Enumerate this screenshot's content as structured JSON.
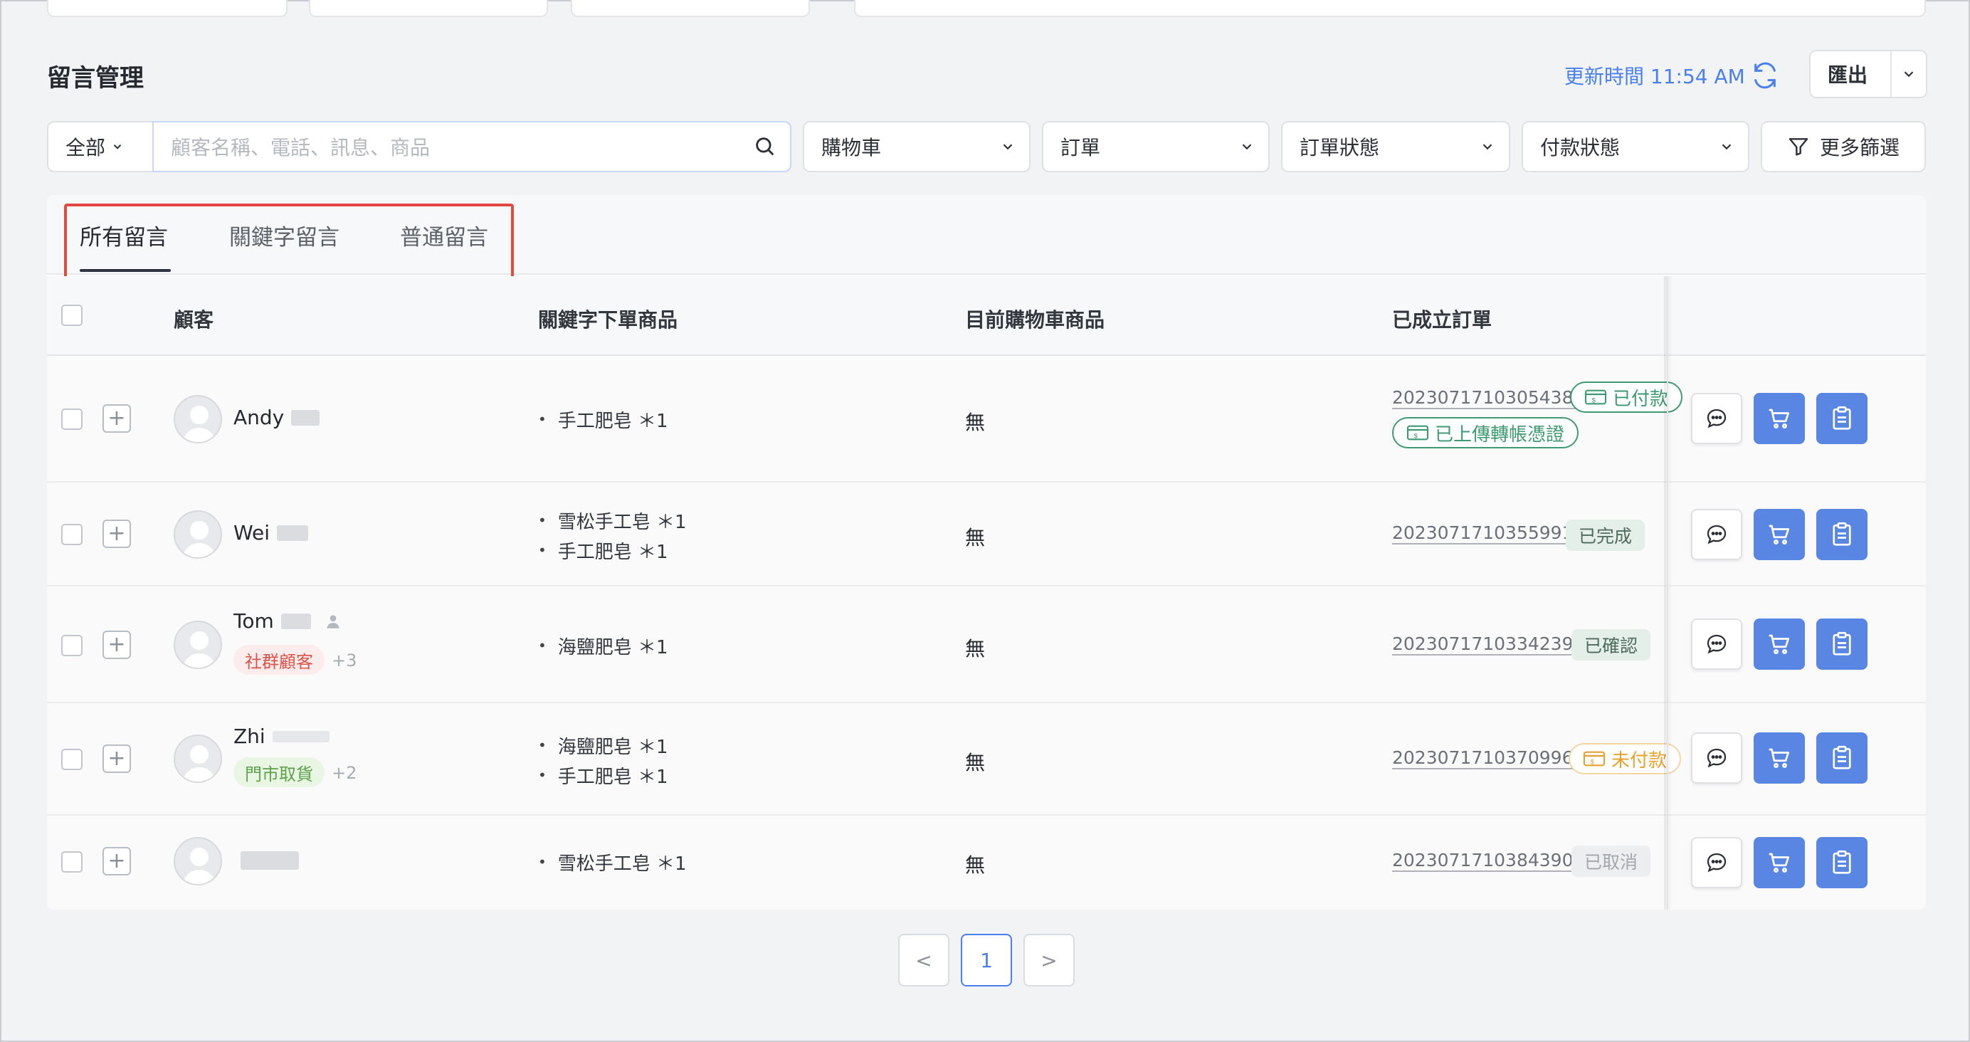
{
  "page": {
    "title": "留言管理",
    "update_label": "更新時間 11:54 AM",
    "export_label": "匯出"
  },
  "filters": {
    "scope": "全部",
    "search_placeholder": "顧客名稱、電話、訊息、商品",
    "cart": "購物車",
    "order": "訂單",
    "order_status": "訂單狀態",
    "payment_status": "付款狀態",
    "more": "更多篩選"
  },
  "tabs": [
    "所有留言",
    "關鍵字留言",
    "普通留言"
  ],
  "columns": {
    "customer": "顧客",
    "keyword_products": "關鍵字下單商品",
    "cart_products": "目前購物車商品",
    "orders": "已成立訂單"
  },
  "rows": [
    {
      "name": "Andy",
      "products": [
        "手工肥皂 ＊1"
      ],
      "cart": "無",
      "order_no": "20230717103054382",
      "status": "已付款",
      "status2": "已上傳轉帳憑證"
    },
    {
      "name": "Wei",
      "products": [
        "雪松手工皂 ＊1",
        "手工肥皂 ＊1"
      ],
      "cart": "無",
      "order_no": "20230717103559915",
      "status": "已完成"
    },
    {
      "name": "Tom",
      "tag": "社群顧客",
      "tag_more": "+3",
      "products": [
        "海鹽肥皂 ＊1"
      ],
      "cart": "無",
      "order_no": "20230717103342398",
      "status": "已確認"
    },
    {
      "name": "Zhi",
      "tag": "門市取貨",
      "tag_more": "+2",
      "products": [
        "海鹽肥皂 ＊1",
        "手工肥皂 ＊1"
      ],
      "cart": "無",
      "order_no": "20230717103709969",
      "status": "未付款"
    },
    {
      "name": "",
      "products": [
        "雪松手工皂 ＊1"
      ],
      "cart": "無",
      "order_no": "20230717103843905",
      "status": "已取消"
    }
  ],
  "pagination": {
    "prev": "<",
    "current": "1",
    "next": ">"
  },
  "colors": {
    "accent": "#4a7ff0",
    "action_blue": "#5985e3",
    "highlight_red": "#e14b3f",
    "paid_green": "#3d9a72",
    "unpaid_orange": "#e7a12e"
  }
}
